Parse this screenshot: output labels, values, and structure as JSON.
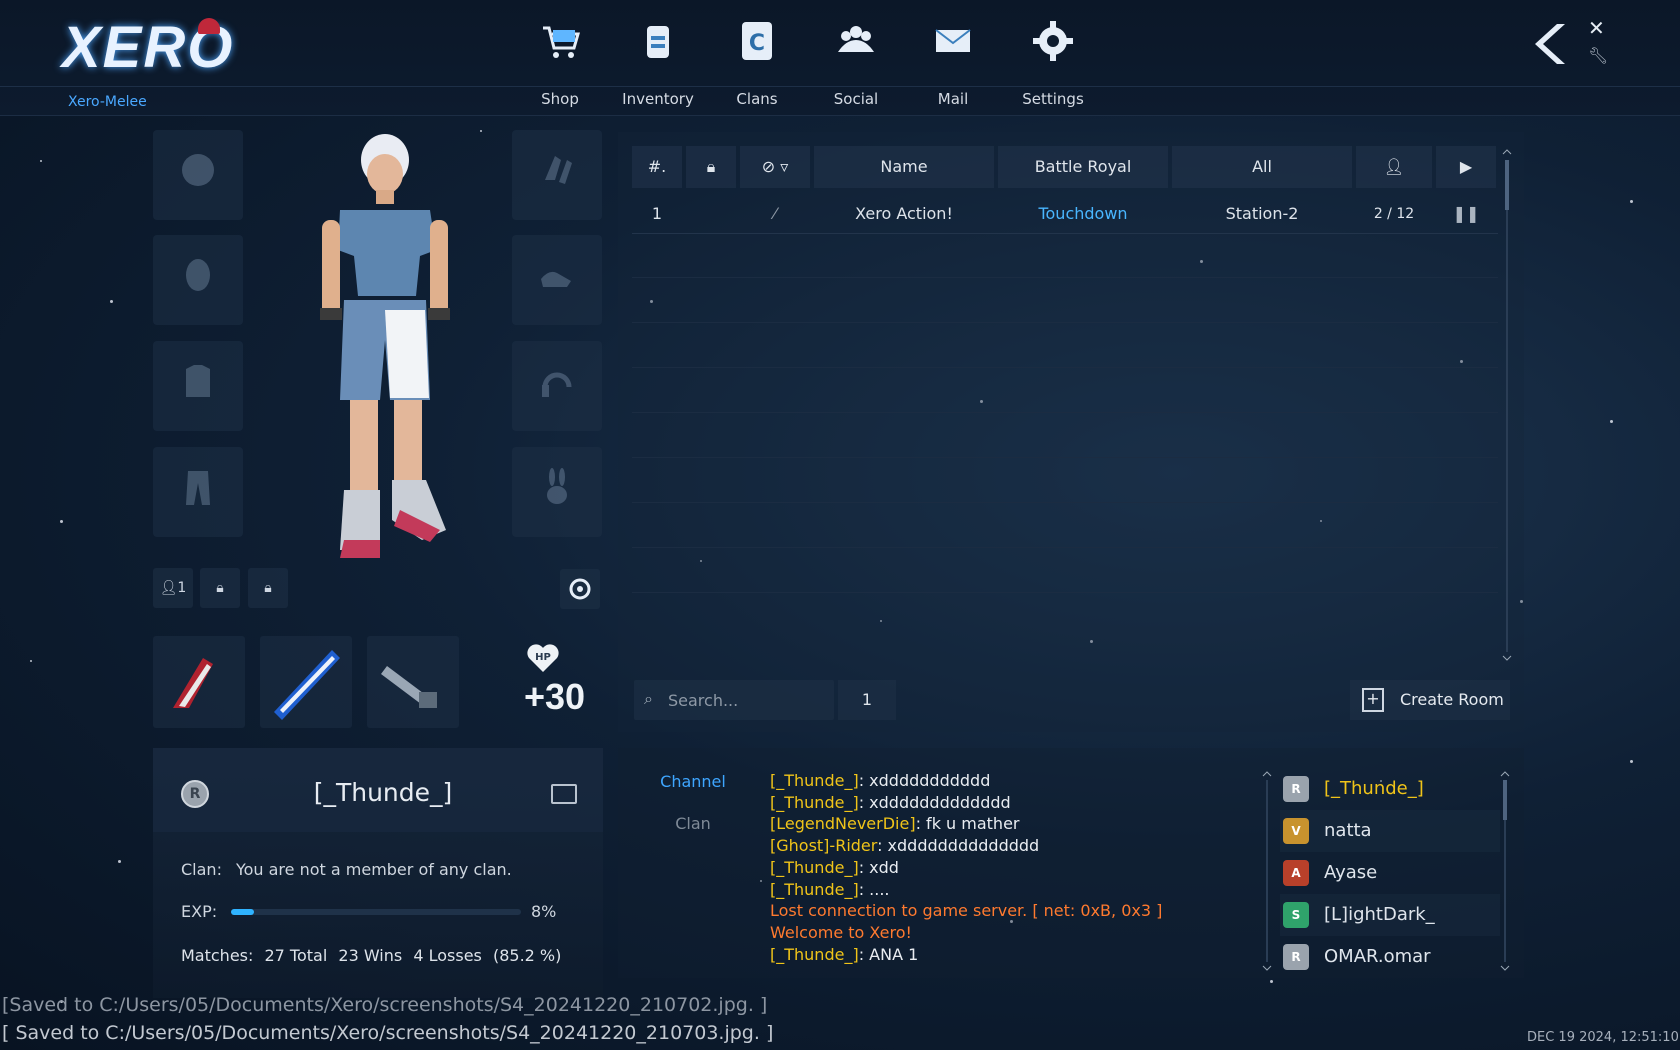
{
  "app": {
    "logo": "XERO",
    "server": "Xero-Melee"
  },
  "nav": [
    {
      "label": "Shop",
      "icon": "shop-cart-icon"
    },
    {
      "label": "Inventory",
      "icon": "inventory-icon"
    },
    {
      "label": "Clans",
      "icon": "clans-icon"
    },
    {
      "label": "Social",
      "icon": "social-icon"
    },
    {
      "label": "Mail",
      "icon": "mail-icon"
    },
    {
      "label": "Settings",
      "icon": "settings-gear-icon"
    }
  ],
  "character": {
    "buttons": [
      "1",
      "",
      ""
    ],
    "hp_bonus": "+30",
    "hp_label": "HP"
  },
  "profile": {
    "name": "[_Thunde_]",
    "rank_badge": "R",
    "clan_label": "Clan:",
    "clan_value": "You are not a member of any clan.",
    "exp_label": "EXP:",
    "exp_percent": "8%",
    "exp_fraction": 0.08,
    "matches_label": "Matches:",
    "matches_total": "27 Total",
    "matches_wins": "23 Wins",
    "matches_losses": "4 Losses",
    "matches_ratio": "(85.2 %)"
  },
  "rooms": {
    "headers": {
      "number": "#.",
      "name": "Name",
      "mode": "Battle Royal",
      "map": "All"
    },
    "rows": [
      {
        "number": "1",
        "name": "Xero Action!",
        "mode": "Touchdown",
        "map": "Station-2",
        "players": "2 / 12"
      }
    ],
    "search_placeholder": "Search...",
    "page": "1",
    "create_room": "Create Room"
  },
  "chat": {
    "tabs": [
      "Channel",
      "Clan"
    ],
    "messages": [
      {
        "who": "[_Thunde_]",
        "text": ": xddddddddddd",
        "type": "user"
      },
      {
        "who": "[_Thunde_]",
        "text": ": xddddddddddddd",
        "type": "user"
      },
      {
        "who": "[LegendNeverDie]",
        "text": ": fk u mather",
        "type": "user"
      },
      {
        "who": "[Ghost]-Rider",
        "text": ": xdddddddddddddd",
        "type": "user"
      },
      {
        "who": "[_Thunde_]",
        "text": ": xdd",
        "type": "user"
      },
      {
        "who": "[_Thunde_]",
        "text": ": ....",
        "type": "user"
      },
      {
        "who": "",
        "text": "Lost connection to game server. [ net: 0xB, 0x3 ]",
        "type": "system"
      },
      {
        "who": "",
        "text": "Welcome to Xero!",
        "type": "system"
      },
      {
        "who": "[_Thunde_]",
        "text": ": ANA 1",
        "type": "user"
      }
    ]
  },
  "users": [
    {
      "name": "[_Thunde_]",
      "badge": "R",
      "color": "#f0c419",
      "badge_color": "#9aa3ad"
    },
    {
      "name": "natta",
      "badge": "V",
      "color": "#dfe5ec",
      "badge_color": "#c8932e"
    },
    {
      "name": "Ayase",
      "badge": "A",
      "color": "#dfe5ec",
      "badge_color": "#b8402a"
    },
    {
      "name": "[L]ightDark_",
      "badge": "S",
      "color": "#dfe5ec",
      "badge_color": "#2fa36b"
    },
    {
      "name": "OMAR.omar",
      "badge": "R",
      "color": "#dfe5ec",
      "badge_color": "#9aa3ad"
    }
  ],
  "status": {
    "saved_1": "[Saved to C:/Users/05/Documents/Xero/screenshots/S4_20241220_210702.jpg. ]",
    "saved_2": "[ Saved to C:/Users/05/Documents/Xero/screenshots/S4_20241220_210703.jpg. ]",
    "clock": "DEC 19 2024, 12:51:10"
  },
  "colors": {
    "accent": "#4aa8ff",
    "highlight": "#f0c419",
    "system": "#ff7a2f",
    "mode": "#49b6ff"
  }
}
